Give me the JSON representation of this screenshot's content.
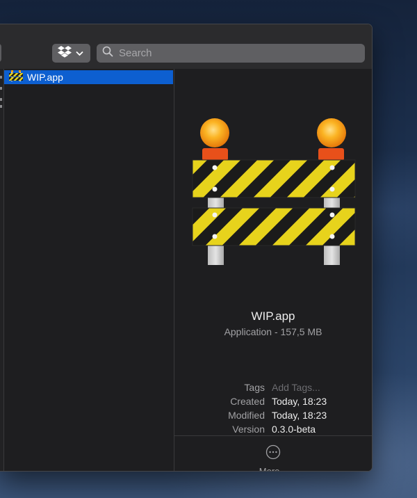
{
  "toolbar": {
    "dropbox_icon": "dropbox-icon",
    "dropdown_icon": "chevron-down-icon",
    "search_icon": "search-icon",
    "search_placeholder": "Search"
  },
  "file_list": {
    "items": [
      {
        "label": "WIP.app",
        "icon": "barricade-app-icon",
        "selected": true
      }
    ]
  },
  "preview": {
    "icon": "construction-barricade-icon",
    "name": "WIP.app",
    "kind": "Application - 157,5 MB",
    "metadata": [
      {
        "key": "Tags",
        "value": "Add Tags..."
      },
      {
        "key": "Created",
        "value": "Today, 18:23"
      },
      {
        "key": "Modified",
        "value": "Today, 18:23"
      },
      {
        "key": "Version",
        "value": "0.3.0-beta"
      }
    ],
    "more_icon": "ellipsis-circle-icon",
    "more_label": "More..."
  },
  "colors": {
    "selection": "#0d5fd0",
    "stripe_yellow": "#e7d31c",
    "lamp_orange": "#f7a21b"
  }
}
